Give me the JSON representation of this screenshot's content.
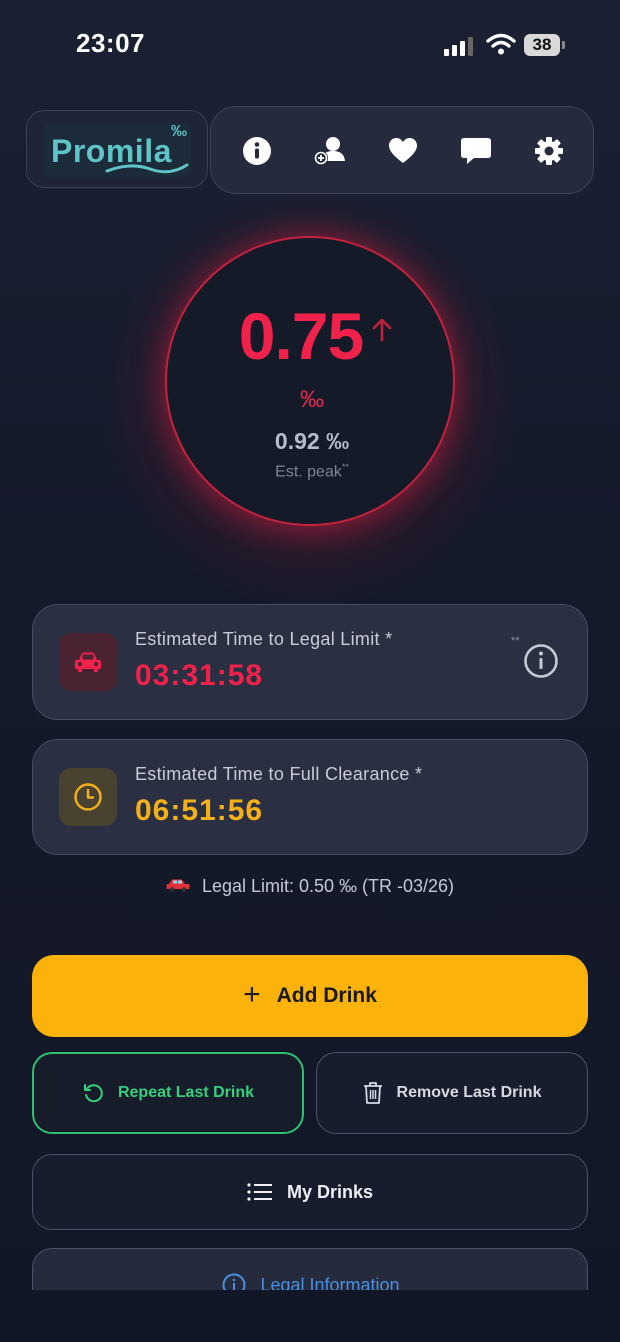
{
  "status_bar": {
    "time": "23:07",
    "battery": "38"
  },
  "logo": {
    "text": "Promila",
    "suffix": "‰"
  },
  "toolbar": {
    "icons": [
      "info-icon",
      "add-user-icon",
      "heart-icon",
      "chat-icon",
      "gear-icon"
    ]
  },
  "gauge": {
    "value": "0.75",
    "unit": "‰",
    "peak_value": "0.92 ‰",
    "peak_label": "Est. peak",
    "peak_marker": "**",
    "trend": "rising",
    "ring_color": "#c2223e",
    "value_color": "#f0214a"
  },
  "cards": [
    {
      "label": "Estimated Time to Legal Limit *",
      "value": "03:31:58",
      "marker": "**",
      "color": "#f0214a",
      "icon": "car-icon"
    },
    {
      "label": "Estimated Time to Full Clearance *",
      "value": "06:51:56",
      "color": "#f4b018",
      "icon": "clock-icon"
    }
  ],
  "legal_limit": {
    "text": "Legal Limit: 0.50 ‰ (TR -03/26)",
    "icon": "car-icon"
  },
  "buttons": {
    "add_drink": "Add Drink",
    "repeat_last": "Repeat Last Drink",
    "remove_last": "Remove Last Drink",
    "my_drinks": "My Drinks",
    "legal_info": "Legal Information"
  },
  "colors": {
    "accent": "#fbb20a",
    "success": "#2fbf71",
    "danger": "#f0214a",
    "link": "#4a8fe0"
  }
}
